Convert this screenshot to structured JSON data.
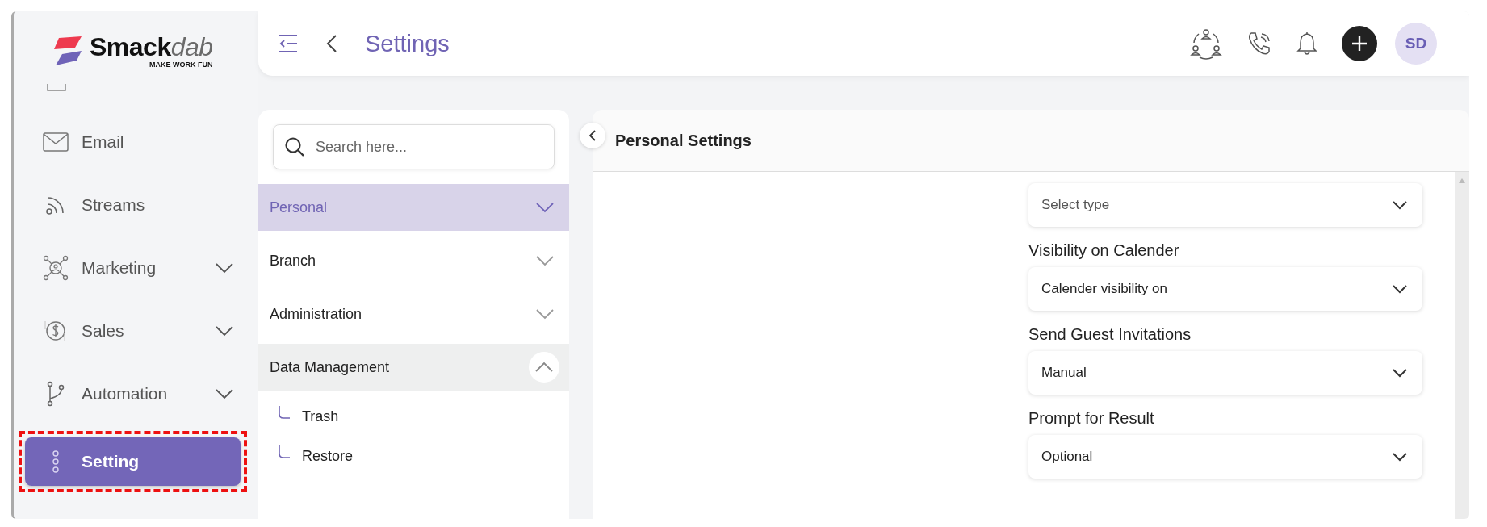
{
  "logo": {
    "name": "Smack",
    "accent": "dab",
    "tagline": "MAKE WORK FUN"
  },
  "sidebar": {
    "items": [
      {
        "label": "Email",
        "has_submenu": false,
        "selected": false,
        "highlighted": false
      },
      {
        "label": "Streams",
        "has_submenu": false,
        "selected": false,
        "highlighted": false
      },
      {
        "label": "Marketing",
        "has_submenu": true,
        "selected": false,
        "highlighted": false
      },
      {
        "label": "Sales",
        "has_submenu": true,
        "selected": false,
        "highlighted": false
      },
      {
        "label": "Automation",
        "has_submenu": true,
        "selected": false,
        "highlighted": false
      },
      {
        "label": "Setting",
        "has_submenu": false,
        "selected": true,
        "highlighted": true
      }
    ]
  },
  "topbar": {
    "title": "Settings",
    "avatar": "SD"
  },
  "settings_nav": {
    "search": {
      "placeholder": "Search here..."
    },
    "sections": [
      {
        "label": "Personal",
        "selected": true,
        "expanded": false
      },
      {
        "label": "Branch",
        "selected": false,
        "expanded": false
      },
      {
        "label": "Administration",
        "selected": false,
        "expanded": false
      },
      {
        "label": "Data Management",
        "selected": false,
        "expanded": true,
        "children": [
          {
            "label": "Trash"
          },
          {
            "label": "Restore"
          }
        ]
      }
    ]
  },
  "panel": {
    "title": "Personal Settings",
    "fields": [
      {
        "placeholder": "Select type"
      },
      {
        "label": "Visibility on Calender",
        "value": "Calender visibility on"
      },
      {
        "label": "Send Guest Invitations",
        "value": "Manual"
      },
      {
        "label": "Prompt for Result",
        "value": "Optional"
      }
    ]
  }
}
